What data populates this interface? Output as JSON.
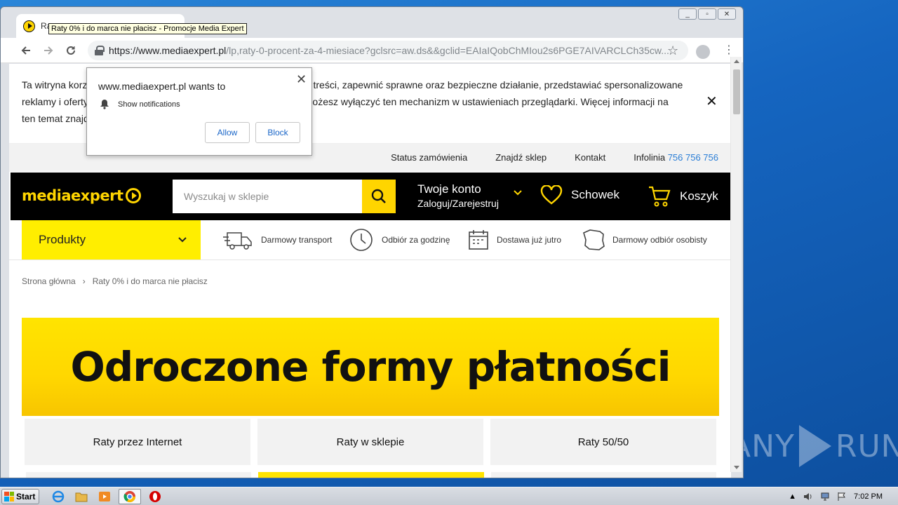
{
  "browser": {
    "tab_title": "Raty 0% i do marca nie płacisz - Promocje Media Expert",
    "tab_title_visible": "Ra",
    "tooltip": "Raty 0% i do marca nie płacisz - Promocje Media Expert",
    "url_domain": "https://www.mediaexpert.pl",
    "url_path": "/lp,raty-0-procent-za-4-miesiace?gclsrc=aw.ds&&gclid=EAIaIQobChMIou2s6PGE7AIVARCLCh35cw...",
    "window_controls": {
      "minimize": "_",
      "restore": "▫",
      "close": "✕"
    }
  },
  "permission_popup": {
    "question": "www.mediaexpert.pl wants to",
    "permission": "Show notifications",
    "allow_label": "Allow",
    "block_label": "Block"
  },
  "cookie_notice": {
    "text": "Ta witryna korzysta z plików cookies, aby dostosować wyświetlane treści, zapewnić sprawne oraz bezpieczne działanie, przedstawiać spersonalizowane reklamy i oferty, a także w celach analitycznych i statystycznych. Możesz wyłączyć ten mechanizm w ustawieniach przeglądarki. Więcej informacji na ten temat znajdziesz w Polityce prywatności.",
    "close": "✕"
  },
  "util_links": {
    "order_status": "Status zamówienia",
    "find_store": "Znajdź sklep",
    "contact": "Kontakt",
    "infoline_label": "Infolinia",
    "infoline_number": "756 756 756"
  },
  "header": {
    "logo_text": "mediaexpert",
    "search_placeholder": "Wyszukaj w sklepie",
    "account_title": "Twoje konto",
    "account_sub": "Zaloguj/Zarejestruj",
    "wishlist": "Schowek",
    "cart": "Koszyk"
  },
  "category_bar": {
    "products": "Produkty",
    "features": [
      "Darmowy transport",
      "Odbiór za godzinę",
      "Dostawa już jutro",
      "Darmowy odbiór osobisty"
    ]
  },
  "breadcrumb": {
    "home": "Strona główna",
    "separator": "›",
    "current": "Raty 0% i do marca nie płacisz"
  },
  "banner": {
    "title": "Odroczone formy płatności"
  },
  "payment_tabs": [
    "Raty przez Internet",
    "Raty w sklepie",
    "Raty 50/50"
  ],
  "watermark": {
    "left": "ANY",
    "right": "RUN"
  },
  "taskbar": {
    "start": "Start",
    "clock": "7:02 PM"
  },
  "colors": {
    "brand_yellow": "#ffd500",
    "header_black": "#000000",
    "link_blue": "#2b7ed6"
  }
}
